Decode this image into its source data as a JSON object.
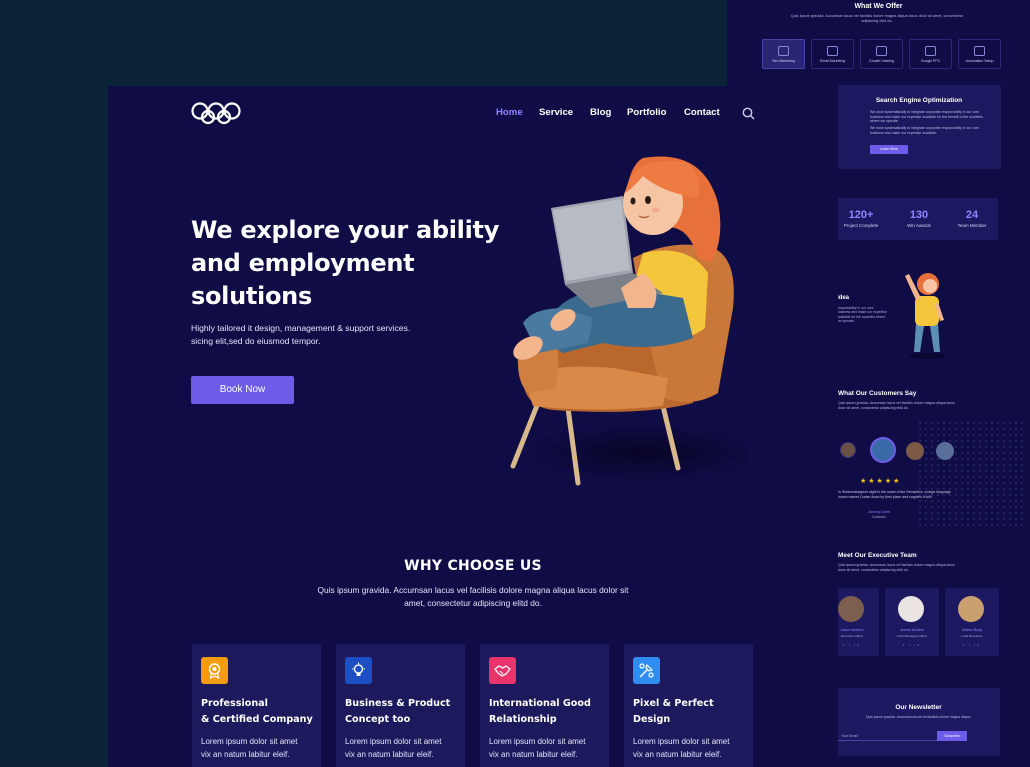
{
  "back_page": {
    "offer_title": "What We Offer",
    "offer_desc": "Quis ipsum gravida. Accumsan lacus vel facilisis dolore magna aliqua lacus dolor sit amet, consectetur adipiscing elitd do.",
    "tabs": [
      {
        "label": "Seo Marketing",
        "icon": "chart-icon"
      },
      {
        "label": "Email Marketing",
        "icon": "email-icon"
      },
      {
        "label": "Growth Hacking",
        "icon": "briefcase-icon"
      },
      {
        "label": "Google PPC",
        "icon": "click-icon"
      },
      {
        "label": "Automation Setup",
        "icon": "gear-icon"
      }
    ],
    "seo_title": "Search Engine Optimization",
    "seo_p1": "We work systematically to integrate corporate responsibility in our core business and make our expertise available for the benefit of the societies where we operate.",
    "seo_p2": "We work systematically to integrate corporate responsibility in our core business and make our expertise available.",
    "seo_button": "Learn More",
    "stats": [
      {
        "number": "120+",
        "label": "Project Complete"
      },
      {
        "number": "130",
        "label": "Win Awards"
      },
      {
        "number": "24",
        "label": "Team Member"
      }
    ],
    "idea_title": "Idea",
    "idea_text": "responsibility in our core business and make our expertise available for the societies where we operate.",
    "customers_title": "What Our Customers Say",
    "customers_desc": "Quis ipsum gravida. Accumsan lacus vel facilisis dolore magna aliqua lacus dolor sit amet, consectetur adipiscing elitd do.",
    "stars": "★★★★★",
    "quote": "In Stoikomahagevir alght in the onset of the Semantics, a large language ocean named Duden flows by their place and supplies it with",
    "customer_name": "Johnny Deel",
    "customer_role": "Customer",
    "team_title": "Meet Our Executive Team",
    "team_desc": "Quis ipsum gravida. Accumsan lacus vel facilisis dolore magna aliqua lacus dolor sit amet, consectetur adipiscing elitd do.",
    "team": [
      {
        "name": "Jason Anders",
        "role": "Executive Officer",
        "social": "f t in"
      },
      {
        "name": "Jennie Anders",
        "role": "Chief Managing Officer",
        "social": "f t in"
      },
      {
        "name": "Alaina Bcay",
        "role": "Lead Developer",
        "social": "f t in"
      }
    ],
    "newsletter_title": "Our Newsletter",
    "newsletter_desc": "Quis ipsum gravida. Accumsan lacus vel facilisis dolore magna aliqua.",
    "newsletter_placeholder": "Your Email",
    "newsletter_button": "Subscribe"
  },
  "front_page": {
    "nav": [
      "Home",
      "Service",
      "Blog",
      "Portfolio",
      "Contact"
    ],
    "headline_lines": [
      "We explore your ability",
      "and employment",
      "solutions"
    ],
    "subtext_lines": [
      "Highly tailored it design, management & support services.",
      "sicing elit,sed do eiusmod tempor."
    ],
    "cta": "Book Now",
    "why_title": "WHY CHOOSE US",
    "why_desc_lines": [
      "Quis ipsum gravida. Accumsan lacus vel facilisis dolore magna aliqua lacus dolor sit",
      "amet, consectetur adipiscing elitd do."
    ],
    "cards": [
      {
        "title_lines": [
          "Professional",
          "& Certified Company"
        ],
        "desc_lines": [
          "Lorem ipsum dolor sit amet",
          "vix an natum labitur eleif."
        ],
        "icon": "certificate-icon",
        "color": "#f39c12"
      },
      {
        "title_lines": [
          "Business & Product",
          "Concept too"
        ],
        "desc_lines": [
          "Lorem ipsum dolor sit amet",
          "vix an natum labitur eleif."
        ],
        "icon": "bulb-icon",
        "color": "#1d4fc4"
      },
      {
        "title_lines": [
          "International Good",
          "Relationship"
        ],
        "desc_lines": [
          "Lorem ipsum dolor sit amet",
          "vix an natum labitur eleif."
        ],
        "icon": "handshake-icon",
        "color": "#e8336b"
      },
      {
        "title_lines": [
          "Pixel & Perfect",
          "Design"
        ],
        "desc_lines": [
          "Lorem ipsum dolor sit amet",
          "vix an natum labitur eleif."
        ],
        "icon": "design-icon",
        "color": "#2f8cf0"
      }
    ]
  },
  "colors": {
    "page_bg": "#0a2336",
    "site_bg": "#100c45",
    "accent": "#6c5ce7",
    "nav_active": "#8f86ff",
    "card_bg": "#1c1a5c"
  }
}
